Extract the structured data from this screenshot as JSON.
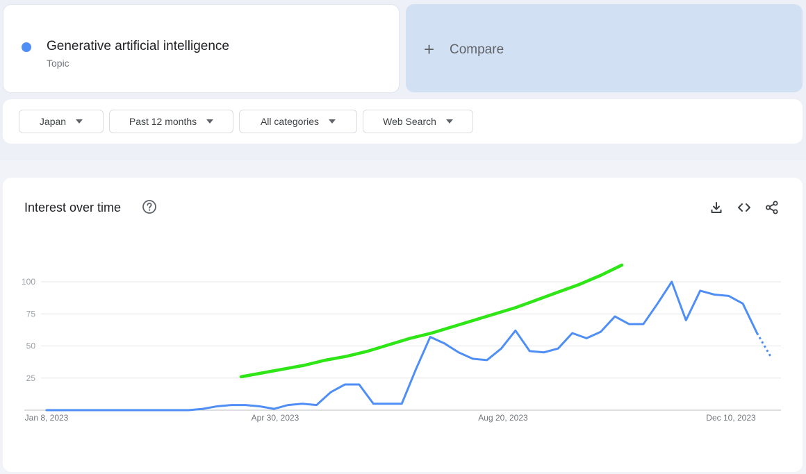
{
  "search_term": {
    "name": "Generative artificial intelligence",
    "type": "Topic",
    "color": "#4f8ff5"
  },
  "compare": {
    "label": "Compare",
    "icon": "plus-icon"
  },
  "filters": {
    "region": "Japan",
    "time_range": "Past 12 months",
    "category": "All categories",
    "property": "Web Search"
  },
  "chart_panel": {
    "title": "Interest over time",
    "icons": [
      "help-icon",
      "download-icon",
      "embed-code-icon",
      "share-icon"
    ]
  },
  "chart_data": {
    "type": "line",
    "title": "Interest over time",
    "x_tick_labels": [
      "Jan 8, 2023",
      "Apr 30, 2023",
      "Aug 20, 2023",
      "Dec 10, 2023"
    ],
    "y_ticks": [
      25,
      50,
      75,
      100
    ],
    "ylim": [
      0,
      100
    ],
    "grid": true,
    "series": [
      {
        "color": "#4f8ff5",
        "partial_last_point": true,
        "values": [
          0,
          0,
          0,
          0,
          0,
          0,
          0,
          0,
          0,
          0,
          0,
          1,
          3,
          4,
          4,
          3,
          1,
          4,
          5,
          4,
          14,
          20,
          20,
          5,
          5,
          5,
          32,
          57,
          52,
          45,
          40,
          39,
          48,
          62,
          46,
          45,
          48,
          60,
          56,
          61,
          73,
          67,
          67,
          83,
          100,
          70,
          93,
          90,
          89,
          83,
          60,
          41
        ]
      }
    ],
    "annotation_overlay": {
      "color": "#2ee516",
      "description_values": [
        26,
        29,
        32,
        35,
        39,
        42,
        46,
        51,
        56,
        60,
        65,
        70,
        75,
        80,
        86,
        92,
        98,
        105,
        113
      ]
    }
  }
}
